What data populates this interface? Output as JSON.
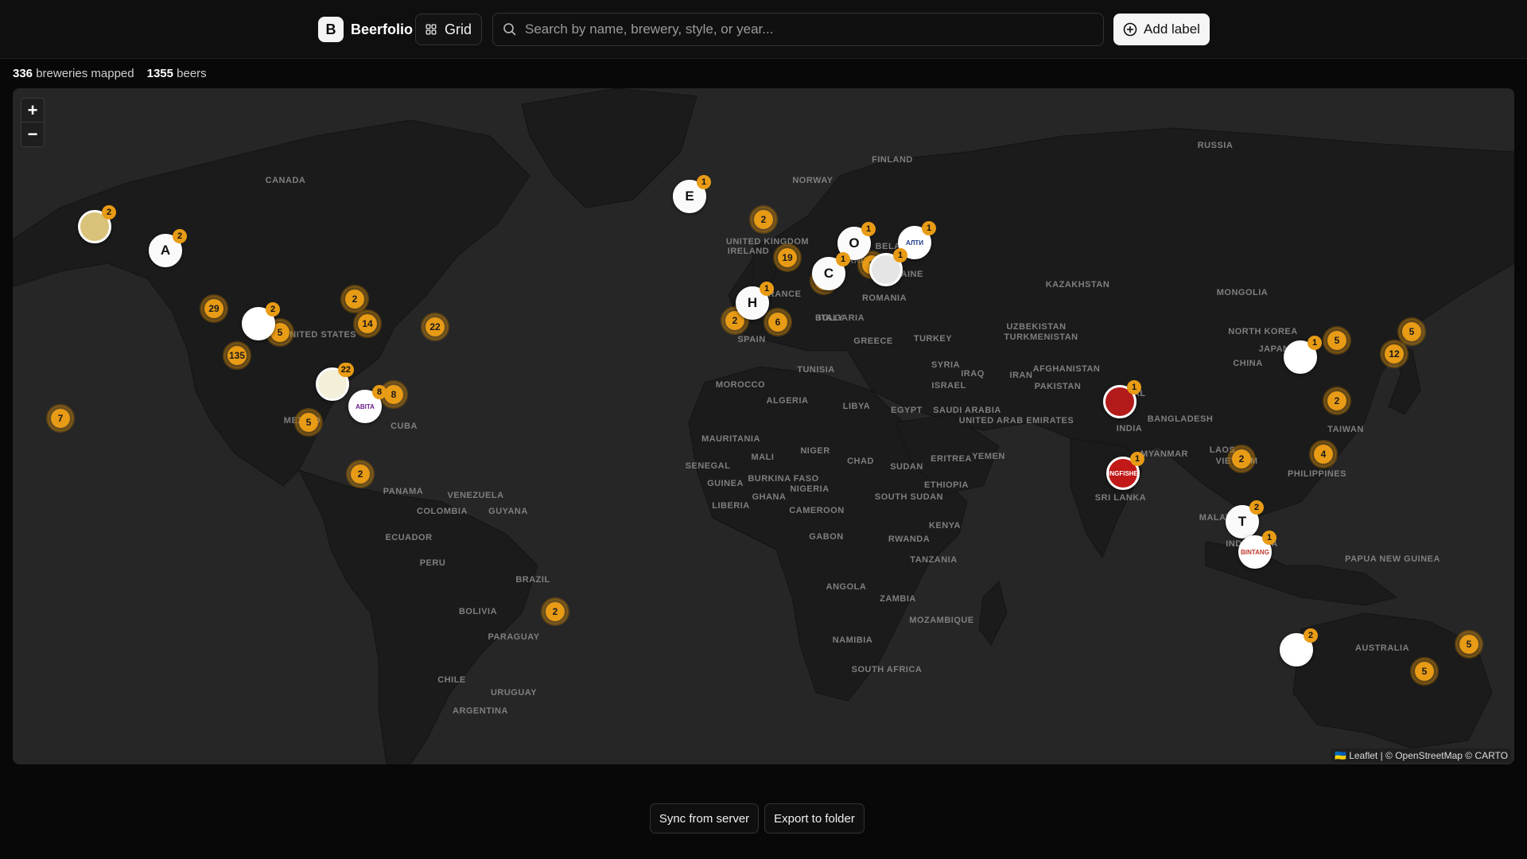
{
  "header": {
    "brand_letter": "B",
    "brand_name": "Beerfolio",
    "view_label": "Grid",
    "search_placeholder": "Search by name, brewery, style, or year...",
    "add_label": "Add label"
  },
  "stats": {
    "breweries_count": "336",
    "breweries_label": "breweries mapped",
    "beers_count": "1355",
    "beers_label": "beers"
  },
  "map": {
    "zoom_in": "+",
    "zoom_out": "−",
    "attribution": "🇺🇦 Leaflet | © OpenStreetMap © CARTO",
    "country_labels": [
      "RUSSIA",
      "CANADA",
      "FINLAND",
      "NORWAY",
      "KAZAKHSTAN",
      "MONGOLIA",
      "UNITED KINGDOM",
      "IRELAND",
      "BELARUS",
      "UKRAINE",
      "POLAND",
      "FRANCE",
      "ROMANIA",
      "BULGARIA",
      "ITALY",
      "SPAIN",
      "GREECE",
      "TURKEY",
      "UZBEKISTAN",
      "TURKMENISTAN",
      "UNITED STATES",
      "CHINA",
      "NORTH KOREA",
      "JAPAN",
      "IRAQ",
      "IRAN",
      "SYRIA",
      "AFGHANISTAN",
      "PAKISTAN",
      "NEPAL",
      "INDIA",
      "BANGLADESH",
      "TUNISIA",
      "MOROCCO",
      "ALGERIA",
      "LIBYA",
      "EGYPT",
      "SAUDI ARABIA",
      "UNITED ARAB EMIRATES",
      "YEMEN",
      "MEXICO",
      "CUBA",
      "MAURITANIA",
      "MALI",
      "NIGER",
      "CHAD",
      "SUDAN",
      "ERITREA",
      "SENEGAL",
      "GUINEA",
      "BURKINA FASO",
      "NIGERIA",
      "ETHIOPIA",
      "LIBERIA",
      "GHANA",
      "SOUTH SUDAN",
      "CAMEROON",
      "GABON",
      "KENYA",
      "RWANDA",
      "TANZANIA",
      "ANGOLA",
      "ZAMBIA",
      "MOZAMBIQUE",
      "NAMIBIA",
      "SOUTH AFRICA",
      "MYANMAR",
      "LAOS",
      "VIETNAM",
      "PHILIPPINES",
      "SRI LANKA",
      "MALAYSIA",
      "INDONESIA",
      "PAPUA NEW GUINEA",
      "AUSTRALIA",
      "PANAMA",
      "VENEZUELA",
      "GUYANA",
      "COLOMBIA",
      "ECUADOR",
      "PERU",
      "BRAZIL",
      "BOLIVIA",
      "PARAGUAY",
      "CHILE",
      "URUGUAY",
      "ARGENTINA",
      "ISRAEL",
      "TAIWAN"
    ],
    "clusters": [
      "2",
      "19",
      "17",
      "2",
      "2",
      "6",
      "29",
      "135",
      "5",
      "2",
      "14",
      "22",
      "8",
      "5",
      "2",
      "7",
      "2",
      "5",
      "5",
      "12",
      "2",
      "4",
      "2",
      "5",
      "5"
    ],
    "letter_markers": [
      {
        "letter": "E",
        "count": "1"
      },
      {
        "letter": "O",
        "count": "1"
      },
      {
        "letter": "C",
        "count": "1"
      },
      {
        "letter": "H",
        "count": "1"
      },
      {
        "letter": "A",
        "count": "2"
      },
      {
        "letter": "T",
        "count": "2"
      }
    ],
    "logo_markers": [
      {
        "count": "2",
        "name": "alaska-brewery-logo"
      },
      {
        "count": "1",
        "name": "russian-beer-logo"
      },
      {
        "count": "1",
        "name": "baltic-brewery-logo"
      },
      {
        "count": "2",
        "name": "longhorn-brewery-logo"
      },
      {
        "count": "22",
        "name": "spain-brewery-logo"
      },
      {
        "count": "8",
        "name": "abita-beer-logo"
      },
      {
        "count": "1",
        "name": "nepal-brewery-logo"
      },
      {
        "count": "1",
        "name": "kingfisher-beer-logo"
      },
      {
        "count": "1",
        "name": "korea-brewery-logo"
      },
      {
        "count": "1",
        "name": "bintang-beer-logo"
      },
      {
        "count": "2",
        "name": "australia-brewery-logo"
      }
    ],
    "logo_texts": [
      "АЛТИ",
      "ABITA",
      "KINGFISHER",
      "BINTANG"
    ]
  },
  "footer": {
    "sync_label": "Sync from server",
    "export_label": "Export to folder"
  },
  "colors": {
    "accent": "#e89b15",
    "map_land": "#1c1c1c",
    "map_water": "#262626"
  }
}
